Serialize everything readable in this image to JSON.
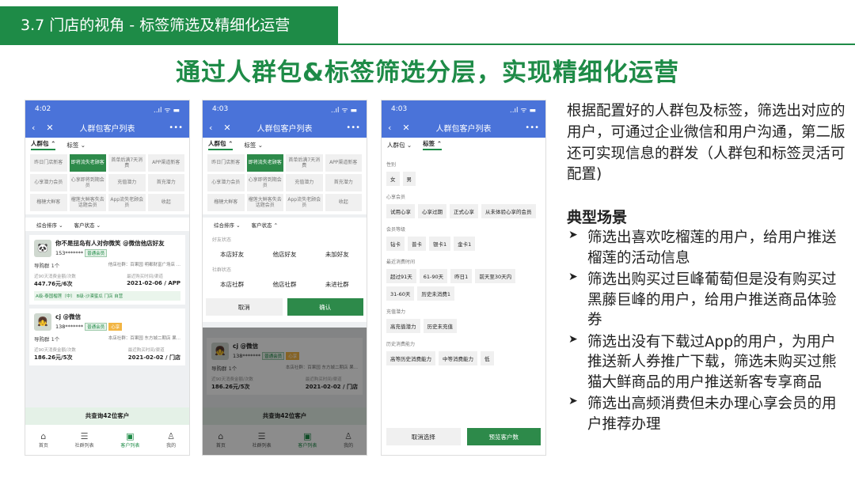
{
  "header": {
    "section_title": "3.7 门店的视角 - 标签筛选及精细化运营",
    "headline": "通过人群包&标签筛选分层，实现精细化运营"
  },
  "phone1": {
    "time": "4:02",
    "signal": "..ıl ᯤ ▬",
    "nav_title": "人群包客户列表",
    "more": "•••",
    "tab_group": "人群包 ⌃",
    "tab_tag": "标签 ⌄",
    "chips": [
      "昨日门店新客",
      "即将流失老顾客",
      "首单后满7天消费",
      "APP渠道新客",
      "心享潜力会员",
      "心享即将到期会员",
      "充值潜力",
      "首充潜力",
      "榴槤大鲜客",
      "榴莲大鲜客失去话题会员",
      "App流失老顾会员",
      "收起"
    ],
    "sort": "综合排序 ⌄",
    "state": "客户状态 ⌄",
    "cards": [
      {
        "avatar": "🐼",
        "name": "你不是扭岛有人对你微笑 @微信他店好友",
        "phone": "153*******",
        "badge": "普通会员",
        "group": "导购群 1个",
        "store": "他店社群：百果园 明都财富广场店 ...",
        "k1": "近90天消费金额/次数",
        "v1": "447.76元/6次",
        "k2": "最近购买时间/渠道",
        "v2": "2021-02-06 / APP",
        "tags": "A级-泰国榴莲（中）  B级-沙漠蜜瓜  门店  自营"
      },
      {
        "avatar": "👧",
        "name": "cj @微信",
        "phone": "138*******",
        "badge": "普通会员",
        "badge2": "心享",
        "group": "导购群 1个",
        "store": "本店社群：百果园 东方城二期店 果...",
        "k1": "近90天消费金额/次数",
        "v1": "186.26元/5次",
        "k2": "最近购买时间/渠道",
        "v2": "2021-02-02 / 门店"
      }
    ],
    "summary": "共查询42位客户",
    "tabbar": [
      {
        "icon": "⌂",
        "label": "首页"
      },
      {
        "icon": "☰",
        "label": "社群列表"
      },
      {
        "icon": "▣",
        "label": "客户列表"
      },
      {
        "icon": "♙",
        "label": "我的"
      }
    ]
  },
  "phone2": {
    "time": "4:03",
    "signal": "..ıl ᯤ ▬",
    "nav_title": "人群包客户列表",
    "more": "•••",
    "tab_group": "人群包 ⌃",
    "tab_tag": "标签 ⌄",
    "chips": [
      "昨日门店新客",
      "即将流失老顾客",
      "首单后满7天消费",
      "APP渠道新客",
      "心享潜力会员",
      "心享即将到期会员",
      "充值潜力",
      "首充潜力",
      "榴槤大鲜客",
      "榴莲大鲜客失去话题会员",
      "App流失老顾会员",
      "收起"
    ],
    "sort": "综合排序 ⌄",
    "state": "客户状态 ⌃",
    "sec1": "好友状态",
    "opts1": [
      "本店好友",
      "他店好友",
      "未加好友"
    ],
    "sec2": "社群状态",
    "opts2": [
      "本店社群",
      "他店社群",
      "未进社群"
    ],
    "cancel": "取消",
    "confirm": "确认",
    "cards": [
      {
        "avatar": "👧",
        "name": "cj @微信",
        "phone": "138*******",
        "badge": "普通会员",
        "badge2": "心享",
        "group": "导购群 1个",
        "store": "本店社群：百果园 东方城二期店 果...",
        "k1": "近90天消费金额/次数",
        "v1": "186.26元/5次",
        "k2": "最近购买时间/渠道",
        "v2": "2021-02-02 / 门店"
      }
    ],
    "summary": "共查询42位客户",
    "tabbar": [
      {
        "icon": "⌂",
        "label": "首页"
      },
      {
        "icon": "☰",
        "label": "社群列表"
      },
      {
        "icon": "▣",
        "label": "客户列表"
      },
      {
        "icon": "♙",
        "label": "我的"
      }
    ]
  },
  "phone3": {
    "time": "4:03",
    "signal": "..ıl ᯤ ▬",
    "nav_title": "人群包客户列表",
    "more": "•••",
    "tab_group": "人群包 ⌄",
    "tab_tag": "标签 ⌃",
    "sections": [
      {
        "title": "性别",
        "chips": [
          "女",
          "男"
        ]
      },
      {
        "title": "心享会员",
        "chips": [
          "试用心享",
          "心享过期",
          "正式心享",
          "从未体验心享的会员"
        ]
      },
      {
        "title": "会员等级",
        "chips": [
          "钻卡",
          "普卡",
          "银卡1",
          "金卡1"
        ]
      },
      {
        "title": "最近消费时间",
        "chips": [
          "超过91天",
          "61-90天",
          "昨日1",
          "前天至30天内",
          "31-60天",
          "历史未消费1"
        ]
      },
      {
        "title": "充值潜力",
        "chips": [
          "高充值潜力",
          "历史未充值"
        ]
      },
      {
        "title": "历史消费能力",
        "chips": [
          "高等历史消费能力",
          "中等消费能力",
          "低"
        ]
      }
    ],
    "clear": "取消选择",
    "preview": "预览客户数"
  },
  "right": {
    "intro": "根据配置好的人群包及标签，筛选出对应的用户，可通过企业微信和用户沟通，第二版还可实现信息的群发（人群包和标签灵活可配置)",
    "subtitle": "典型场景",
    "items": [
      "筛选出喜欢吃榴莲的用户，给用户推送榴莲的活动信息",
      "筛选出购买过巨峰葡萄但是没有购买过黑藤巨峰的用户，给用户推送商品体验券",
      "筛选出没有下载过App的用户，为用户推送新人券推广下载，筛选未购买过熊猫大鲜商品的用户推送新客专享商品",
      "筛选出高频消费但未办理心享会员的用户推荐办理"
    ]
  }
}
